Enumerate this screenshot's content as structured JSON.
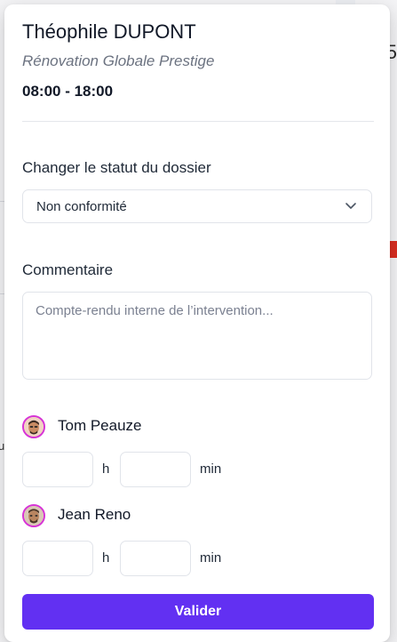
{
  "header": {
    "name": "Théophile DUPONT",
    "company": "Rénovation Globale Prestige",
    "hours": "08:00 - 18:00"
  },
  "status": {
    "label": "Changer le statut du dossier",
    "selected": "Non conformité",
    "icon": "chevron-down-icon"
  },
  "comment": {
    "label": "Commentaire",
    "placeholder": "Compte-rendu interne de l’intervention...",
    "value": ""
  },
  "technicians": [
    {
      "name": "Tom Peauze",
      "hours_unit": "h",
      "minutes_unit": "min",
      "hours": "",
      "minutes": ""
    },
    {
      "name": "Jean Reno",
      "hours_unit": "h",
      "minutes_unit": "min",
      "hours": "",
      "minutes": ""
    }
  ],
  "submit": {
    "label": "Valider"
  },
  "background": {
    "right_glyph": "5",
    "left_glyph": "u"
  },
  "colors": {
    "primary": "#6230f2",
    "avatar_ring": "#d633d6",
    "subtitle": "#6b7280",
    "alert": "#d92d20"
  }
}
